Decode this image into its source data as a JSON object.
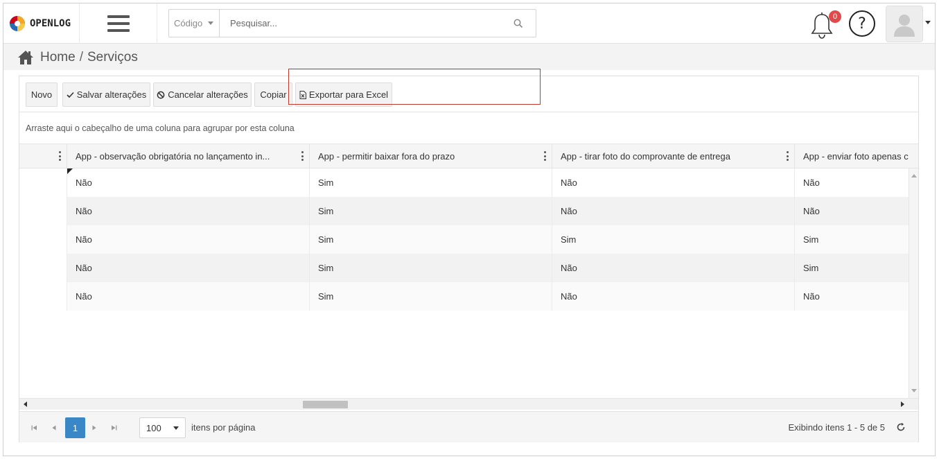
{
  "app": {
    "logo_text": "OPENLOG",
    "brand_colors": [
      "#f5a623",
      "#2b6cb0",
      "#d0021b"
    ]
  },
  "header": {
    "search_select_label": "Código",
    "search_placeholder": "Pesquisar...",
    "notification_count": "0",
    "help_label": "?"
  },
  "breadcrumb": {
    "home": "Home",
    "separator": "/",
    "current": "Serviços"
  },
  "toolbar": {
    "new_label": "Novo",
    "save_label": "Salvar alterações",
    "cancel_label": "Cancelar alterações",
    "copy_label": "Copiar",
    "export_label": "Exportar para Excel"
  },
  "grid": {
    "group_hint": "Arraste aqui o cabeçalho de uma coluna para agrupar por esta coluna",
    "columns": [
      "App - observação obrigatória no lançamento in...",
      "App - permitir baixar fora do prazo",
      "App - tirar foto do comprovante de entrega",
      "App - enviar foto apenas c"
    ],
    "rows": [
      [
        "Não",
        "Sim",
        "Não",
        "Não"
      ],
      [
        "Não",
        "Sim",
        "Não",
        "Não"
      ],
      [
        "Não",
        "Sim",
        "Sim",
        "Sim"
      ],
      [
        "Não",
        "Sim",
        "Não",
        "Sim"
      ],
      [
        "Não",
        "Sim",
        "Não",
        "Não"
      ]
    ],
    "highlight_color": "#c0392b"
  },
  "pager": {
    "current_page": "1",
    "page_size": "100",
    "page_size_label": "itens por página",
    "info": "Exibindo itens 1 - 5 de 5",
    "active_color": "#3a87c8"
  }
}
